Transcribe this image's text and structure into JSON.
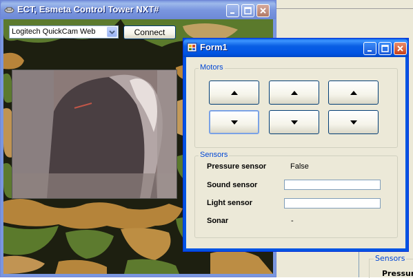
{
  "ect_window": {
    "title": "ECT, Esmeta Control Tower NXT#",
    "camera_select": {
      "value": "Logitech QuickCam Web"
    },
    "connect_label": "Connect"
  },
  "form1": {
    "title": "Form1",
    "motors": {
      "legend": "Motors"
    },
    "sensors": {
      "legend": "Sensors",
      "pressure": {
        "label": "Pressure sensor",
        "value": "False"
      },
      "sound": {
        "label": "Sound sensor",
        "value": ""
      },
      "light": {
        "label": "Light sensor",
        "value": ""
      },
      "sonar": {
        "label": "Sonar",
        "value": "-"
      }
    }
  },
  "background_window": {
    "sensors_legend": "Sensors",
    "pressure_text": "Pressur"
  },
  "colors": {
    "title_active": "#0054e3",
    "title_inactive": "#7a96df",
    "face": "#ece9d8",
    "group_label": "#0046d5"
  }
}
